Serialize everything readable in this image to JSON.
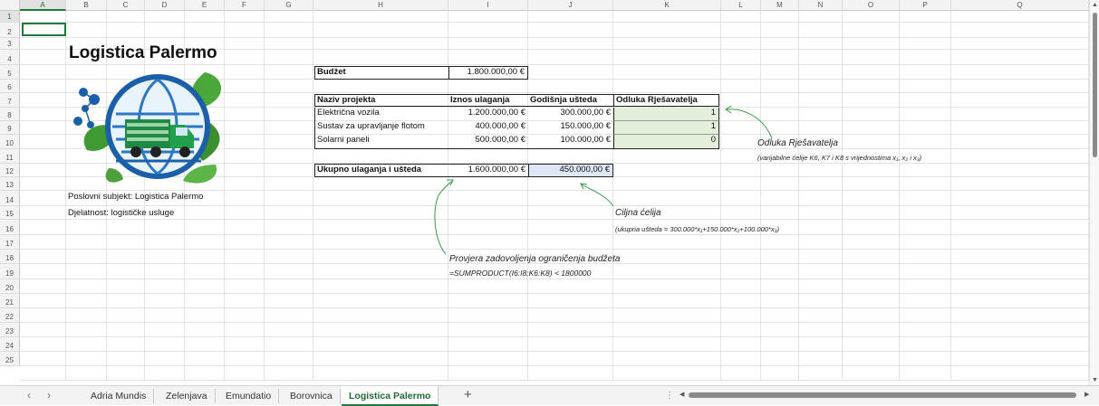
{
  "columns": [
    "A",
    "B",
    "C",
    "D",
    "E",
    "F",
    "G",
    "H",
    "I",
    "J",
    "K",
    "L",
    "M",
    "N",
    "O",
    "P",
    "Q"
  ],
  "rows": [
    "1",
    "2",
    "3",
    "4",
    "5",
    "6",
    "7",
    "8",
    "9",
    "10",
    "11",
    "12",
    "13",
    "14",
    "15",
    "16",
    "17",
    "18",
    "19",
    "20",
    "21",
    "22",
    "23",
    "24",
    "25"
  ],
  "title": "Logistica Palermo",
  "budget": {
    "label": "Budžet",
    "value": "1.800.000,00 €"
  },
  "table": {
    "headers": [
      "Naziv projekta",
      "Iznos ulaganja",
      "Godišnja ušteda",
      "Odluka Rješavatelja"
    ],
    "rows": [
      {
        "name": "Električna vozila",
        "invest": "1.200.000,00 €",
        "saving": "300.000,00 €",
        "decision": "1"
      },
      {
        "name": "Sustav za upravljanje flotom",
        "invest": "400.000,00 €",
        "saving": "150.000,00 €",
        "decision": "1"
      },
      {
        "name": "Solarni paneli",
        "invest": "500.000,00 €",
        "saving": "100.000,00 €",
        "decision": "0"
      }
    ]
  },
  "totals": {
    "label": "Ukupno ulaganja i ušteda",
    "invest": "1.600.000,00 €",
    "saving": "450.000,00 €"
  },
  "company": {
    "subject": "Poslovni subjekt: Logistica Palermo",
    "activity": "Djelatnost: logističke usluge"
  },
  "notes": {
    "decision_title": "Odluka Rješavatelja",
    "decision_sub": "(varijabilne ćelije K6, K7 i K8 s vrijednostima x₁, x₂ i x₃)",
    "target_title": "Ciljna ćelija",
    "target_sub": "(ukupna ušteda = 300.000*x₁+150.000*x₂+100.000*x₃)",
    "budget_title": "Provjera zadovoljenja ograničenja budžeta",
    "budget_formula": "=SUMPRODUCT(I6:I8;K6:K8) < 1800000"
  },
  "tabs": [
    "Adria Mundis",
    "Zelenjava",
    "Emundatio",
    "Borovnica",
    "Logistica Palermo"
  ],
  "active_tab": "Logistica Palermo",
  "add_sheet": "+",
  "colors": {
    "accent": "#1d7a3a",
    "decision_fill": "#e2efda",
    "target_fill": "#dde7f6"
  }
}
